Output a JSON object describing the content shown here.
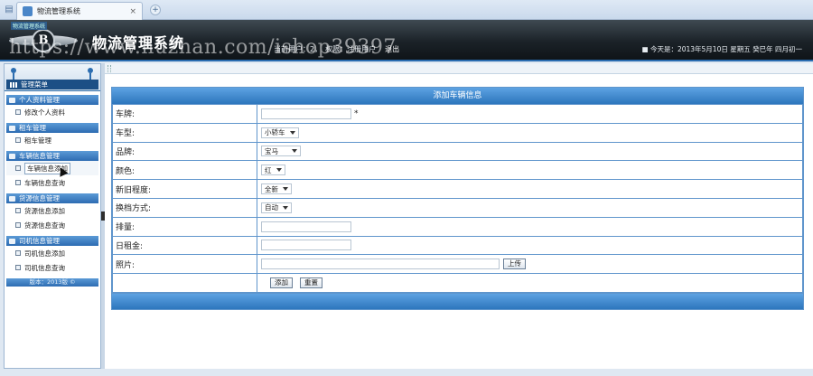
{
  "browser": {
    "tab_title": "物流管理系统",
    "tab_close": "×",
    "new_tab": "+"
  },
  "header": {
    "logo_label": "物流管理系统",
    "logo_letter": "B",
    "app_title": "物流管理系统",
    "current_user": "当前用户：2，",
    "permission": "权限：注册用户",
    "logout": "退出",
    "date_text": "■ 今天是：2013年5月10日 星期五 癸巳年 四月初一",
    "watermark": "https://www.huzhan.com/ishop39397"
  },
  "sidebar": {
    "menu_title": "管理菜单",
    "groups": [
      {
        "title": "个人资料管理",
        "items": [
          "修改个人资料"
        ]
      },
      {
        "title": "租车管理",
        "items": [
          "租车管理"
        ]
      },
      {
        "title": "车辆信息管理",
        "items": [
          "车辆信息添加",
          "车辆信息查询"
        ]
      },
      {
        "title": "货源信息管理",
        "items": [
          "货源信息添加",
          "货源信息查询"
        ]
      },
      {
        "title": "司机信息管理",
        "items": [
          "司机信息添加",
          "司机信息查询"
        ]
      }
    ],
    "footer": "版本：2013版 ©"
  },
  "form": {
    "title": "添加车辆信息",
    "required_mark": "*",
    "fields": {
      "plate": {
        "label": "车牌:"
      },
      "type": {
        "label": "车型:",
        "value": "小轿车"
      },
      "brand": {
        "label": "品牌:",
        "value": "宝马"
      },
      "color": {
        "label": "颜色:",
        "value": "红"
      },
      "condition": {
        "label": "新旧程度:",
        "value": "全新"
      },
      "gear": {
        "label": "换档方式:",
        "value": "自动"
      },
      "displacement": {
        "label": "排量:"
      },
      "rent": {
        "label": "日租金:"
      },
      "photo": {
        "label": "照片:",
        "upload_label": "上传"
      }
    },
    "submit_label": "添加",
    "reset_label": "重置"
  }
}
